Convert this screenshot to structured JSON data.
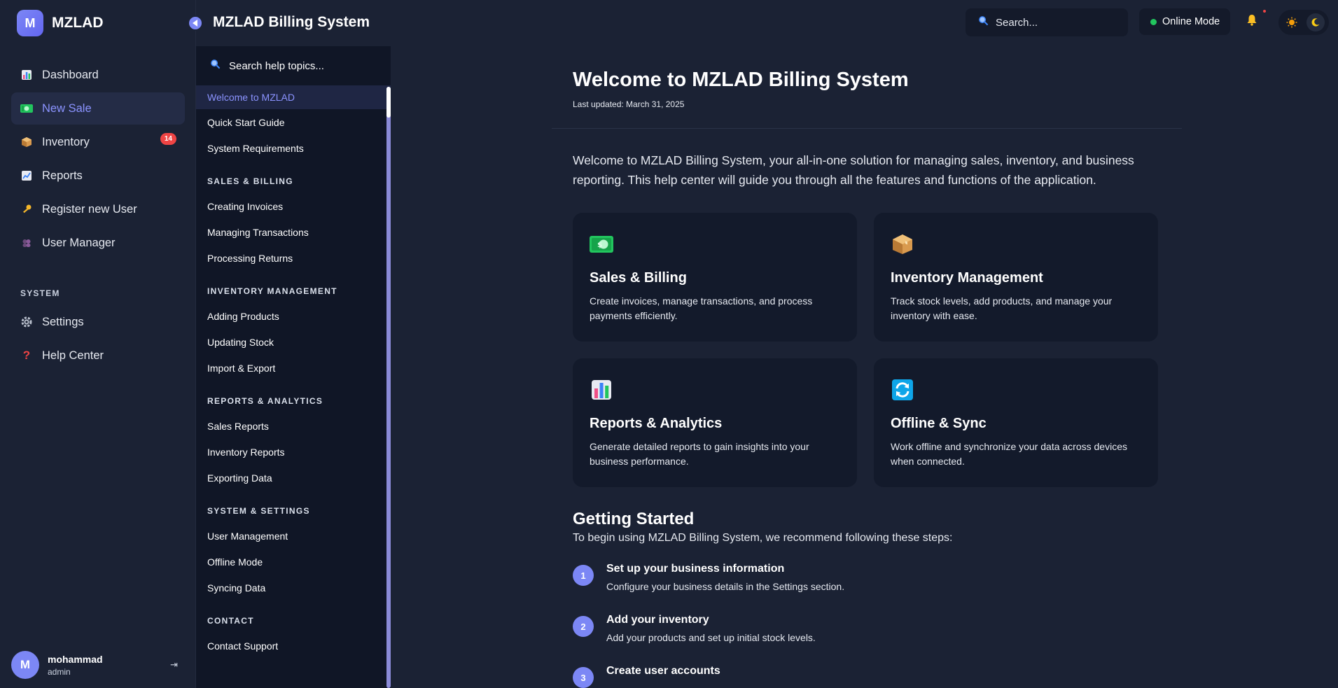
{
  "app": {
    "logo_letter": "M",
    "name": "MZLAD"
  },
  "sidebar": {
    "items": [
      {
        "label": "Dashboard",
        "icon": "bar-chart-icon"
      },
      {
        "label": "New Sale",
        "icon": "money-icon",
        "active": true
      },
      {
        "label": "Inventory",
        "icon": "package-icon",
        "badge": "14"
      },
      {
        "label": "Reports",
        "icon": "trend-chart-icon"
      },
      {
        "label": "Register new User",
        "icon": "key-icon"
      },
      {
        "label": "User Manager",
        "icon": "users-icon"
      }
    ],
    "system_section": "SYSTEM",
    "system_items": [
      {
        "label": "Settings",
        "icon": "gear-icon"
      },
      {
        "label": "Help Center",
        "icon": "question-icon"
      }
    ],
    "user": {
      "initial": "M",
      "name": "mohammad",
      "role": "admin"
    }
  },
  "header": {
    "title": "MZLAD Billing System",
    "search_placeholder": "Search...",
    "status": "Online Mode",
    "status_color": "#22c55e"
  },
  "help": {
    "search_placeholder": "Search help topics...",
    "top_topics": [
      "Welcome to MZLAD",
      "Quick Start Guide",
      "System Requirements"
    ],
    "sections": [
      {
        "title": "SALES & BILLING",
        "topics": [
          "Creating Invoices",
          "Managing Transactions",
          "Processing Returns"
        ]
      },
      {
        "title": "INVENTORY MANAGEMENT",
        "topics": [
          "Adding Products",
          "Updating Stock",
          "Import & Export"
        ]
      },
      {
        "title": "REPORTS & ANALYTICS",
        "topics": [
          "Sales Reports",
          "Inventory Reports",
          "Exporting Data"
        ]
      },
      {
        "title": "SYSTEM & SETTINGS",
        "topics": [
          "User Management",
          "Offline Mode",
          "Syncing Data"
        ]
      },
      {
        "title": "CONTACT",
        "topics": [
          "Contact Support"
        ]
      }
    ]
  },
  "main": {
    "title": "Welcome to MZLAD Billing System",
    "updated": "Last updated: March 31, 2025",
    "intro": "Welcome to MZLAD Billing System, your all-in-one solution for managing sales, inventory, and business reporting. This help center will guide you through all the features and functions of the application.",
    "cards": [
      {
        "icon": "money-icon",
        "title": "Sales & Billing",
        "desc": "Create invoices, manage transactions, and process payments efficiently."
      },
      {
        "icon": "package-icon",
        "title": "Inventory Management",
        "desc": "Track stock levels, add products, and manage your inventory with ease."
      },
      {
        "icon": "bar-chart-icon",
        "title": "Reports & Analytics",
        "desc": "Generate detailed reports to gain insights into your business performance."
      },
      {
        "icon": "sync-icon",
        "title": "Offline & Sync",
        "desc": "Work offline and synchronize your data across devices when connected."
      }
    ],
    "getting_started": {
      "title": "Getting Started",
      "intro": "To begin using MZLAD Billing System, we recommend following these steps:",
      "steps": [
        {
          "num": "1",
          "title": "Set up your business information",
          "desc": "Configure your business details in the Settings section."
        },
        {
          "num": "2",
          "title": "Add your inventory",
          "desc": "Add your products and set up initial stock levels."
        },
        {
          "num": "3",
          "title": "Create user accounts",
          "desc": ""
        }
      ]
    }
  }
}
